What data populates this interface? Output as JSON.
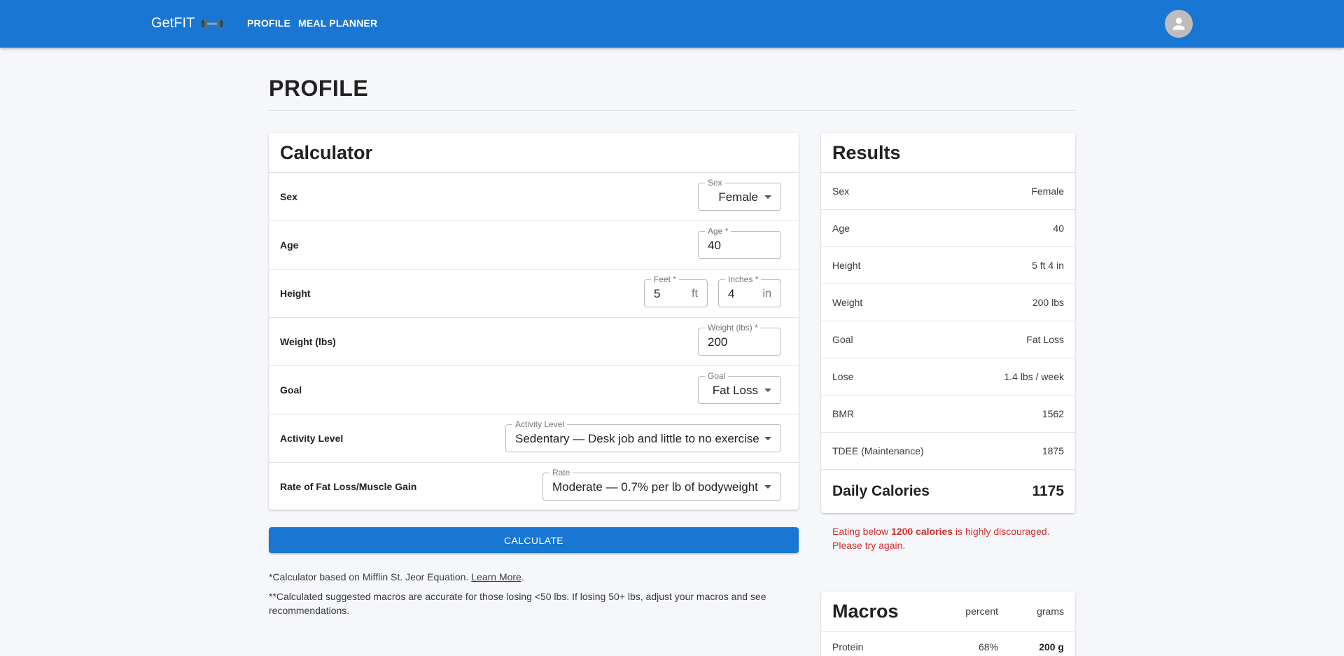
{
  "appbar": {
    "brand": "GetFIT",
    "nav": [
      "PROFILE",
      "MEAL PLANNER"
    ],
    "brand_color": "#1976d2"
  },
  "page": {
    "title": "PROFILE"
  },
  "calculator": {
    "title": "Calculator",
    "rows": {
      "sex": {
        "label": "Sex",
        "field_label": "Sex",
        "value": "Female"
      },
      "age": {
        "label": "Age",
        "field_label": "Age *",
        "value": "40"
      },
      "height": {
        "label": "Height",
        "feet_label": "Feet *",
        "feet_value": "5",
        "feet_unit": "ft",
        "inches_label": "Inches *",
        "inches_value": "4",
        "inches_unit": "in"
      },
      "weight": {
        "label": "Weight (lbs)",
        "field_label": "Weight (lbs) *",
        "value": "200"
      },
      "goal": {
        "label": "Goal",
        "field_label": "Goal",
        "value": "Fat Loss"
      },
      "activity": {
        "label": "Activity Level",
        "field_label": "Activity Level",
        "value": "Sedentary — Desk job and little to no exercise"
      },
      "rate": {
        "label": "Rate of Fat Loss/Muscle Gain",
        "field_label": "Rate",
        "value": "Moderate — 0.7% per lb of bodyweight"
      }
    },
    "button": "CALCULATE",
    "note1_text": "*Calculator based on Mifflin St. Jeor Equation.",
    "note1_link": "Learn More",
    "note1_end": ".",
    "note2": "**Calculated suggested macros are accurate for those losing <50 lbs. If losing 50+ lbs, adjust your macros and see recommendations."
  },
  "results": {
    "title": "Results",
    "rows": [
      {
        "label": "Sex",
        "value": "Female"
      },
      {
        "label": "Age",
        "value": "40"
      },
      {
        "label": "Height",
        "value": "5 ft 4 in"
      },
      {
        "label": "Weight",
        "value": "200 lbs"
      },
      {
        "label": "Goal",
        "value": "Fat Loss"
      },
      {
        "label": "Lose",
        "value": "1.4 lbs / week"
      },
      {
        "label": "BMR",
        "value": "1562"
      },
      {
        "label": "TDEE (Maintenance)",
        "value": "1875"
      }
    ],
    "total_label": "Daily Calories",
    "total_value": "1175",
    "warning_pre": "Eating below ",
    "warning_bold": "1200 calories",
    "warning_post": " is highly discouraged. Please try again.",
    "warning_color": "#d32f2f"
  },
  "macros": {
    "title": "Macros",
    "col_percent": "percent",
    "col_grams": "grams",
    "rows": [
      {
        "name": "Protein",
        "percent": "68%",
        "grams": "200 g"
      }
    ]
  }
}
